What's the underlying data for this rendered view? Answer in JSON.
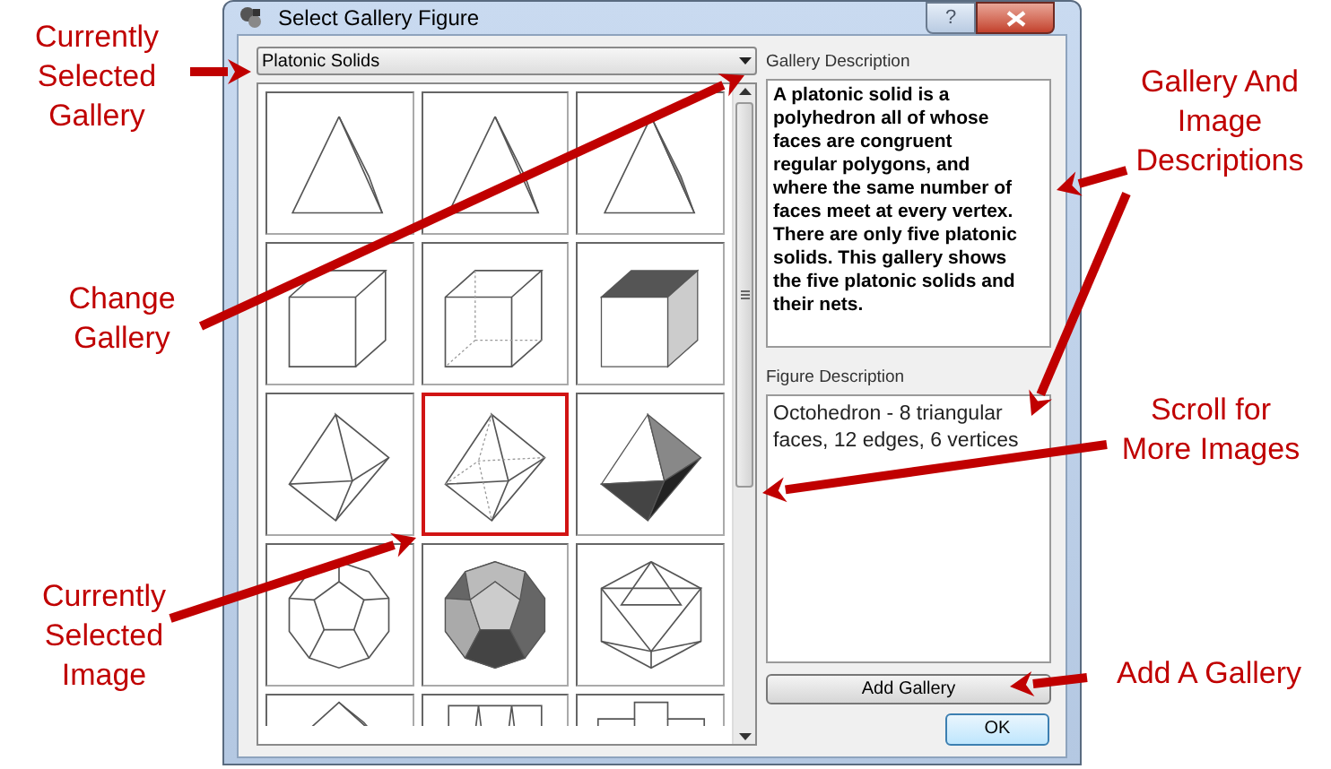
{
  "window": {
    "title": "Select Gallery Figure",
    "help_label": "?"
  },
  "gallery_select": {
    "value": "Platonic Solids"
  },
  "tiles": [
    {
      "kind": "tetra-wire",
      "selected": false
    },
    {
      "kind": "tetra-hidden",
      "selected": false
    },
    {
      "kind": "tetra-shaded",
      "selected": false
    },
    {
      "kind": "cube-wire",
      "selected": false
    },
    {
      "kind": "cube-hidden",
      "selected": false
    },
    {
      "kind": "cube-shaded",
      "selected": false
    },
    {
      "kind": "octa-wire",
      "selected": false
    },
    {
      "kind": "octa-hidden",
      "selected": true
    },
    {
      "kind": "octa-shaded",
      "selected": false
    },
    {
      "kind": "dodeca-wire",
      "selected": false
    },
    {
      "kind": "dodeca-shaded",
      "selected": false
    },
    {
      "kind": "icosa-wire",
      "selected": false
    },
    {
      "kind": "net-a",
      "selected": false
    },
    {
      "kind": "net-b",
      "selected": false
    },
    {
      "kind": "net-c",
      "selected": false
    }
  ],
  "gallery_description": {
    "label": "Gallery Description",
    "text": "A platonic solid is a polyhedron all of whose faces are congruent regular polygons, and where the same number of faces meet at every vertex.  There are only five platonic solids.  This gallery shows the five platonic solids and their nets."
  },
  "figure_description": {
    "label": "Figure Description",
    "text": "Octohedron - 8 triangular faces, 12 edges, 6 vertices"
  },
  "buttons": [
    {
      "kind": "wide",
      "label": "Add Gallery"
    },
    {
      "kind": "ok",
      "label": "OK"
    }
  ],
  "annotations": [
    {
      "text": "Currently Selected Gallery"
    },
    {
      "text": "Change Gallery"
    },
    {
      "text": "Currently Selected Image"
    },
    {
      "text": "Gallery And Image Descriptions"
    },
    {
      "text": "Scroll for More Images"
    },
    {
      "text": "Add A Gallery"
    }
  ]
}
